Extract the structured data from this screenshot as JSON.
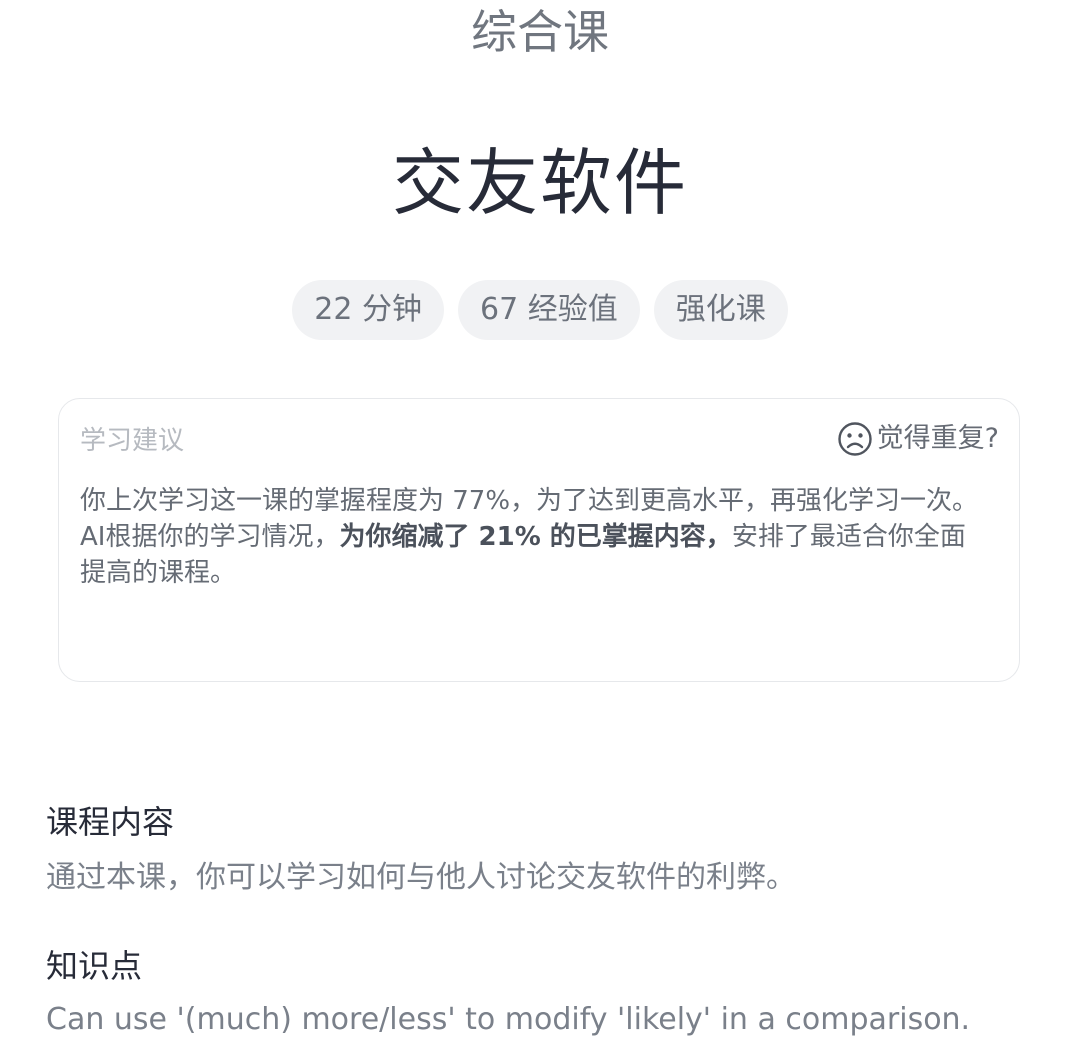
{
  "header": {
    "category": "综合课",
    "title": "交友软件"
  },
  "tags": [
    {
      "label": "22 分钟"
    },
    {
      "label": "67 经验值"
    },
    {
      "label": "强化课"
    }
  ],
  "advice": {
    "label": "学习建议",
    "repeat_icon": "sad-face-icon",
    "repeat_label": "觉得重复?",
    "line1": "你上次学习这一课的掌握程度为 77%，为了达到更高水平，再强化学习一次。",
    "line2_pre": "AI根据你的学习情况，",
    "line2_bold": "为你缩减了 21% 的已掌握内容，",
    "line2_post": "安排了最适合你全面",
    "line3": "提高的课程。"
  },
  "content": {
    "heading": "课程内容",
    "body": "通过本课，你可以学习如何与他人讨论交友软件的利弊。"
  },
  "knowledge": {
    "heading": "知识点",
    "body": "Can use '(much) more/less' to modify 'likely' in a comparison."
  }
}
